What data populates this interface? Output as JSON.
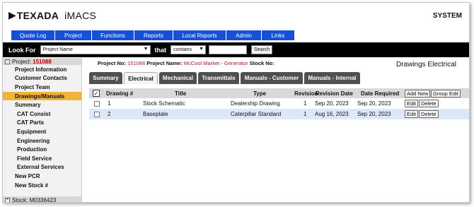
{
  "header": {
    "logo_mark": "▶",
    "logo_text": "TEXADA",
    "app_name": "iMACS",
    "system_label": "SYSTEM"
  },
  "nav": [
    "Quote Log",
    "Project",
    "Functions",
    "Reports",
    "Local Reports",
    "Admin",
    "Links"
  ],
  "lookup": {
    "look_for_label": "Look For",
    "field_value": "Project Name",
    "that_label": "that",
    "operator_value": "contains",
    "search_text": "",
    "search_button": "Search"
  },
  "sidebar": {
    "project_label": "Project:",
    "project_number": "151088",
    "items": [
      "Project Information",
      "Customer Contacts",
      "Project Team",
      "Drawings/Manuals",
      "Summary",
      "CAT Consist",
      "CAT Parts",
      "Equipment",
      "Engineering",
      "Production",
      "Field Service",
      "External Services",
      "New PCR",
      "New Stock #"
    ],
    "stock_label": "Stock: M0336423"
  },
  "project_info": {
    "project_no_label": "Project No:",
    "project_no": "151088",
    "project_name_label": "Project Name:",
    "project_name": "McCool Market - Generator",
    "stock_no_label": "Stock No:",
    "stock_no": ""
  },
  "page_title": "Drawings Electrical",
  "tabs": [
    "Summary",
    "Electrical",
    "Mechanical",
    "Transmittals",
    "Manuals - Customer",
    "Manuals - Internal"
  ],
  "active_tab": "Electrical",
  "table": {
    "columns": {
      "check": "✓",
      "drawing": "Drawing #",
      "title": "Title",
      "type": "Type",
      "revision": "Revision",
      "revision_date": "Revision Date",
      "date_required": "Date Required",
      "add_new": "Add New",
      "group_edit": "Group Edit"
    },
    "rows": [
      {
        "drawing": "1",
        "title": "Stock Schematic",
        "type": "Dealership Drawing",
        "revision": "1",
        "revision_date": "Sep 20, 2023",
        "date_required": "Sep 20, 2023",
        "edit": "Edit",
        "delete": "Delete"
      },
      {
        "drawing": "2",
        "title": "Baseplate",
        "type": "Caterpillar Standard",
        "revision": "1",
        "revision_date": "Aug 16, 2023",
        "date_required": "Sep 20, 2023",
        "edit": "Edit",
        "delete": "Delete"
      }
    ]
  },
  "colors": {
    "nav_blue": "#1650d6",
    "active_orange": "#f2b33d",
    "project_red": "#b00000",
    "tab_gray": "#505050",
    "row_alt": "#dce8f8"
  }
}
